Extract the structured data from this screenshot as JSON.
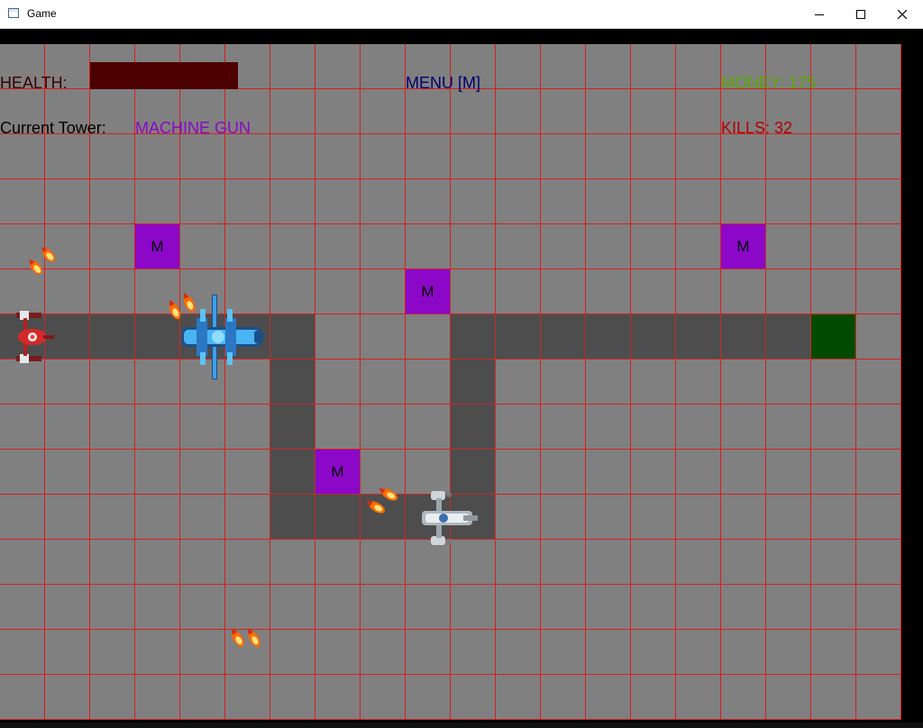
{
  "window": {
    "title": "Game",
    "icon": "app-window-icon"
  },
  "hud": {
    "health_label": "HEALTH:",
    "health_fraction": 1.0,
    "menu_label": "MENU [M]",
    "money_label": "MONEY: 175",
    "current_tower_label": "Current Tower:",
    "current_tower_value": "MACHINE GUN",
    "kills_label": "KILLS: 32"
  },
  "board": {
    "tower_marker": "M"
  },
  "colors": {
    "grass": "#808080",
    "grid_line": "#d91e1e",
    "path": "#4d4d4d",
    "tower": "#8b08c8",
    "base": "#004b00",
    "health": "#3a0000",
    "money": "#5aa800",
    "kills": "#b30000",
    "menu": "#00006e"
  },
  "sprites": [
    "red-ship",
    "blue-ship",
    "white-ship",
    "fireball"
  ]
}
